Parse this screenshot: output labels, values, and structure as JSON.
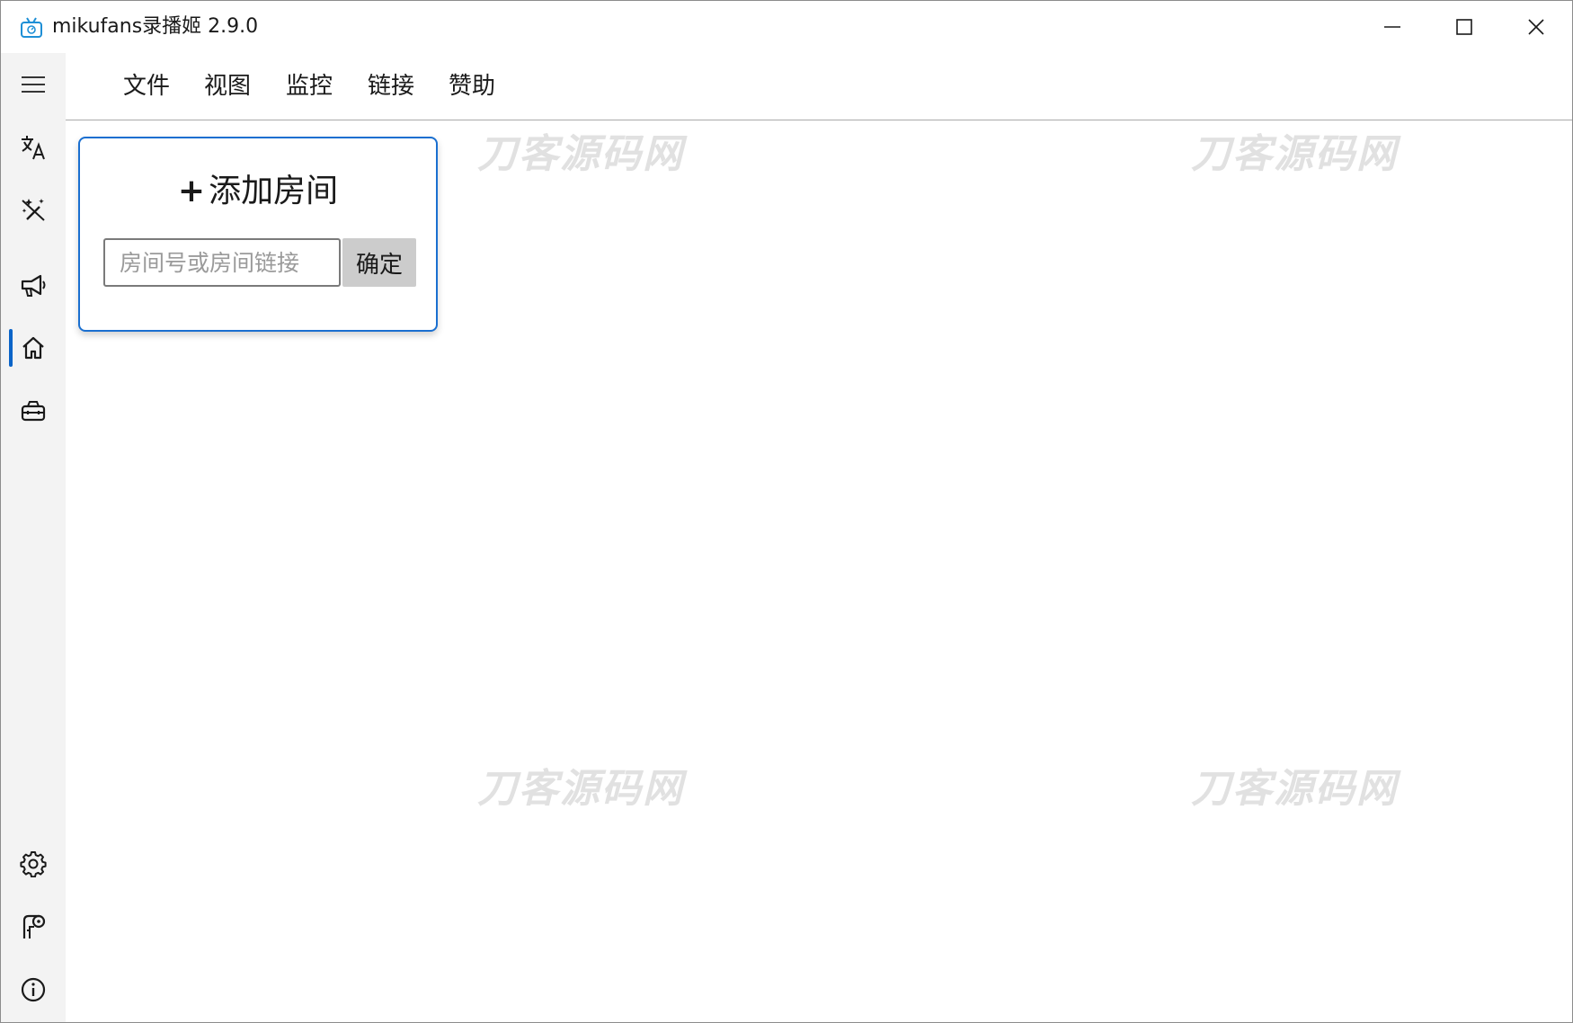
{
  "window": {
    "title": "mikufans录播姬 2.9.0"
  },
  "menu": {
    "items": [
      "文件",
      "视图",
      "监控",
      "链接",
      "赞助"
    ]
  },
  "sidebar": {
    "items": [
      {
        "icon": "menu-icon"
      },
      {
        "icon": "translate-icon"
      },
      {
        "icon": "magic-wand-off-icon"
      },
      {
        "icon": "megaphone-icon"
      },
      {
        "icon": "home-icon",
        "active": true
      },
      {
        "icon": "toolbox-icon"
      },
      {
        "icon": "gear-icon"
      },
      {
        "icon": "log-icon"
      },
      {
        "icon": "info-icon"
      }
    ]
  },
  "add_room": {
    "plus": "+",
    "title": "添加房间",
    "placeholder": "房间号或房间链接",
    "value": "",
    "confirm_label": "确定"
  },
  "watermark": {
    "text": "刀客源码网"
  },
  "colors": {
    "accent": "#1a6fd0",
    "sidebar_bg": "#f3f3f3",
    "button_bg": "#cccccc"
  }
}
